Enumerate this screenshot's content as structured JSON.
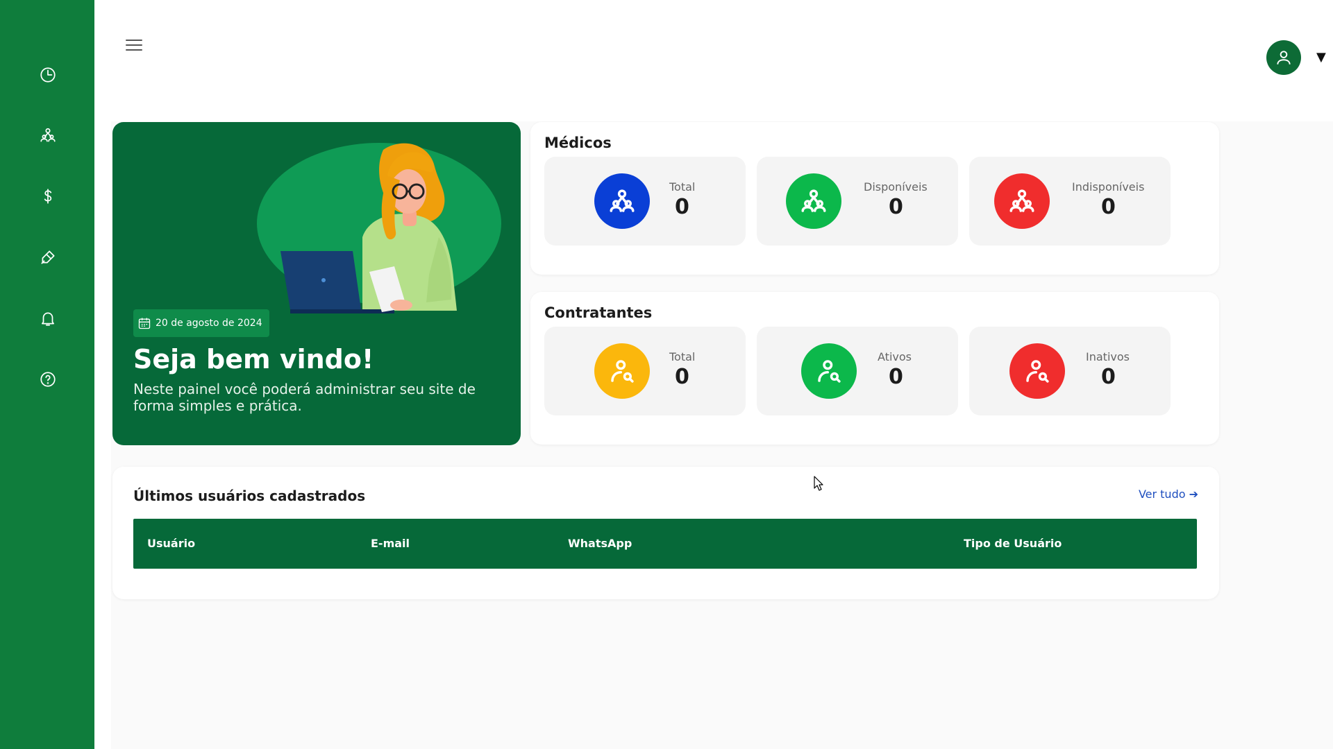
{
  "sidebar": {
    "items": [
      {
        "icon": "pie-chart-icon"
      },
      {
        "icon": "users-icon"
      },
      {
        "icon": "dollar-icon"
      },
      {
        "icon": "medicine-icon"
      },
      {
        "icon": "bell-icon"
      },
      {
        "icon": "help-icon"
      }
    ],
    "bg_color": "#0f7d3c"
  },
  "header": {
    "menu_icon": "hamburger-icon",
    "avatar_icon": "user-icon",
    "caret": "▼"
  },
  "welcome": {
    "date": "20 de agosto de 2024",
    "title": "Seja bem vindo!",
    "text": "Neste painel você poderá administrar seu site de forma simples e prática.",
    "bg_color": "#066939"
  },
  "medicos": {
    "title": "Médicos",
    "stats": [
      {
        "label": "Total",
        "value": "0",
        "color": "#0a3fd6",
        "icon": "users-icon"
      },
      {
        "label": "Disponíveis",
        "value": "0",
        "color": "#0cb84b",
        "icon": "users-icon"
      },
      {
        "label": "Indisponíveis",
        "value": "0",
        "color": "#f02d2d",
        "icon": "users-icon"
      }
    ]
  },
  "contratantes": {
    "title": "Contratantes",
    "stats": [
      {
        "label": "Total",
        "value": "0",
        "color": "#fbb70c",
        "icon": "user-search-icon"
      },
      {
        "label": "Ativos",
        "value": "0",
        "color": "#0cb84b",
        "icon": "user-search-icon"
      },
      {
        "label": "Inativos",
        "value": "0",
        "color": "#f02d2d",
        "icon": "user-search-icon"
      }
    ]
  },
  "users_table": {
    "title": "Últimos usuários cadastrados",
    "link": "Ver tudo ➔",
    "columns": [
      "Usuário",
      "E-mail",
      "WhatsApp",
      "Tipo de Usuário"
    ],
    "rows": []
  }
}
